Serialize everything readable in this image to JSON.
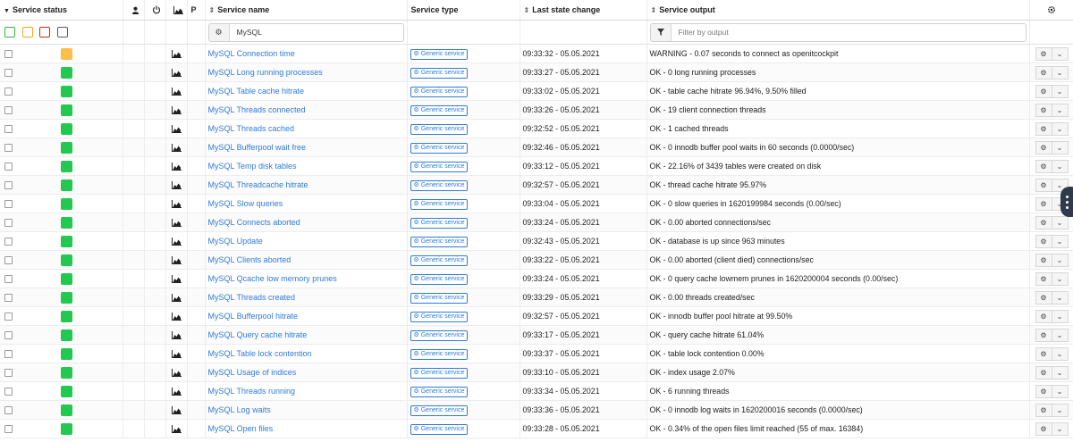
{
  "header": {
    "service_status": "Service status",
    "problem_col": "P",
    "service_name": "Service name",
    "service_type": "Service type",
    "last_state_change": "Last state change",
    "service_output": "Service output"
  },
  "filters": {
    "name_value": "MySQL",
    "output_placeholder": "Filter by output",
    "state_legend_colors": [
      "#38b24a",
      "#f5a623",
      "#d0271b",
      "#5b5b5b"
    ]
  },
  "status_colors": {
    "ok": "#22c84f",
    "warning": "#fdbe47"
  },
  "rows": [
    {
      "status": "warning",
      "name": "MySQL Connection time",
      "type": "Generic service",
      "last_change": "09:33:32 - 05.05.2021",
      "output": "WARNING - 0.07 seconds to connect as openitcockpit"
    },
    {
      "status": "ok",
      "name": "MySQL Long running processes",
      "type": "Generic service",
      "last_change": "09:33:27 - 05.05.2021",
      "output": "OK - 0 long running processes"
    },
    {
      "status": "ok",
      "name": "MySQL Table cache hitrate",
      "type": "Generic service",
      "last_change": "09:33:02 - 05.05.2021",
      "output": "OK - table cache hitrate 96.94%, 9.50% filled"
    },
    {
      "status": "ok",
      "name": "MySQL Threads connected",
      "type": "Generic service",
      "last_change": "09:33:26 - 05.05.2021",
      "output": "OK - 19 client connection threads"
    },
    {
      "status": "ok",
      "name": "MySQL Threads cached",
      "type": "Generic service",
      "last_change": "09:32:52 - 05.05.2021",
      "output": "OK - 1 cached threads"
    },
    {
      "status": "ok",
      "name": "MySQL Bufferpool wait free",
      "type": "Generic service",
      "last_change": "09:32:46 - 05.05.2021",
      "output": "OK - 0 innodb buffer pool waits in 60 seconds (0.0000/sec)"
    },
    {
      "status": "ok",
      "name": "MySQL Temp disk tables",
      "type": "Generic service",
      "last_change": "09:33:12 - 05.05.2021",
      "output": "OK - 22.16% of 3439 tables were created on disk"
    },
    {
      "status": "ok",
      "name": "MySQL Threadcache hitrate",
      "type": "Generic service",
      "last_change": "09:32:57 - 05.05.2021",
      "output": "OK - thread cache hitrate 95.97%"
    },
    {
      "status": "ok",
      "name": "MySQL Slow queries",
      "type": "Generic service",
      "last_change": "09:33:04 - 05.05.2021",
      "output": "OK - 0 slow queries in 1620199984 seconds (0.00/sec)"
    },
    {
      "status": "ok",
      "name": "MySQL Connects aborted",
      "type": "Generic service",
      "last_change": "09:33:24 - 05.05.2021",
      "output": "OK - 0.00 aborted connections/sec"
    },
    {
      "status": "ok",
      "name": "MySQL Update",
      "type": "Generic service",
      "last_change": "09:32:43 - 05.05.2021",
      "output": "OK - database is up since 963 minutes"
    },
    {
      "status": "ok",
      "name": "MySQL Clients aborted",
      "type": "Generic service",
      "last_change": "09:33:22 - 05.05.2021",
      "output": "OK - 0.00 aborted (client died) connections/sec"
    },
    {
      "status": "ok",
      "name": "MySQL Qcache low memory prunes",
      "type": "Generic service",
      "last_change": "09:33:24 - 05.05.2021",
      "output": "OK - 0 query cache lowmem prunes in 1620200004 seconds (0.00/sec)"
    },
    {
      "status": "ok",
      "name": "MySQL Threads created",
      "type": "Generic service",
      "last_change": "09:33:29 - 05.05.2021",
      "output": "OK - 0.00 threads created/sec"
    },
    {
      "status": "ok",
      "name": "MySQL Bufferpool hitrate",
      "type": "Generic service",
      "last_change": "09:32:57 - 05.05.2021",
      "output": "OK - innodb buffer pool hitrate at 99.50%"
    },
    {
      "status": "ok",
      "name": "MySQL Query cache hitrate",
      "type": "Generic service",
      "last_change": "09:33:17 - 05.05.2021",
      "output": "OK - query cache hitrate 61.04%"
    },
    {
      "status": "ok",
      "name": "MySQL Table lock contention",
      "type": "Generic service",
      "last_change": "09:33:37 - 05.05.2021",
      "output": "OK - table lock contention 0.00%"
    },
    {
      "status": "ok",
      "name": "MySQL Usage of indices",
      "type": "Generic service",
      "last_change": "09:33:10 - 05.05.2021",
      "output": "OK - index usage 2.07%"
    },
    {
      "status": "ok",
      "name": "MySQL Threads running",
      "type": "Generic service",
      "last_change": "09:33:34 - 05.05.2021",
      "output": "OK - 6 running threads"
    },
    {
      "status": "ok",
      "name": "MySQL Log waits",
      "type": "Generic service",
      "last_change": "09:33:36 - 05.05.2021",
      "output": "OK - 0 innodb log waits in 1620200016 seconds (0.0000/sec)"
    },
    {
      "status": "ok",
      "name": "MySQL Open files",
      "type": "Generic service",
      "last_change": "09:33:28 - 05.05.2021",
      "output": "OK - 0.34% of the open files limit reached (55 of max. 16384)"
    }
  ]
}
